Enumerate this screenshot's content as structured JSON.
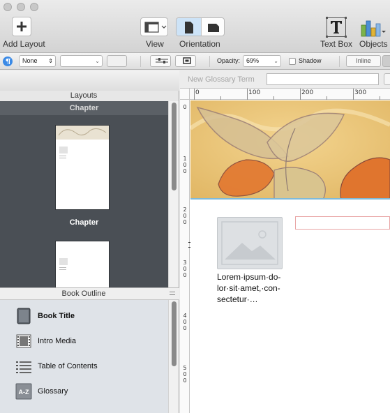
{
  "toolbar": {
    "add_layout": "Add Layout",
    "view": "View",
    "orientation": "Orientation",
    "text_box": "Text Box",
    "objects": "Objects"
  },
  "format_bar": {
    "list_style_value": "None",
    "opacity_label": "Opacity:",
    "opacity_value": "69%",
    "shadow_label": "Shadow",
    "shadow_checked": false,
    "inline_label": "Inline"
  },
  "sidebar": {
    "layouts_title": "Layouts",
    "layouts": [
      {
        "label": "Chapter"
      },
      {
        "label": "Chapter"
      }
    ],
    "outline_title": "Book Outline",
    "outline_items": [
      {
        "label": "Book Title",
        "icon": "book-icon",
        "selected": true
      },
      {
        "label": "Intro Media",
        "icon": "film-icon",
        "selected": false
      },
      {
        "label": "Table of Contents",
        "icon": "list-icon",
        "selected": false
      },
      {
        "label": "Glossary",
        "icon": "a-z-icon",
        "selected": false
      }
    ]
  },
  "canvas": {
    "glossary_placeholder": "New Glossary Term",
    "ruler_top": [
      "0",
      "100",
      "200",
      "300"
    ],
    "ruler_left": [
      "0",
      "100",
      "200",
      "300",
      "400",
      "500"
    ],
    "caption": "Lorem·ipsum·do-lor·sit·amet,·con-sectetur·…"
  },
  "colors": {
    "layouts_bg": "#4a4f55",
    "outline_bg": "#dfe3e8",
    "active_toggle": "#cde3f7",
    "selection_outline": "#e8a3a3"
  }
}
